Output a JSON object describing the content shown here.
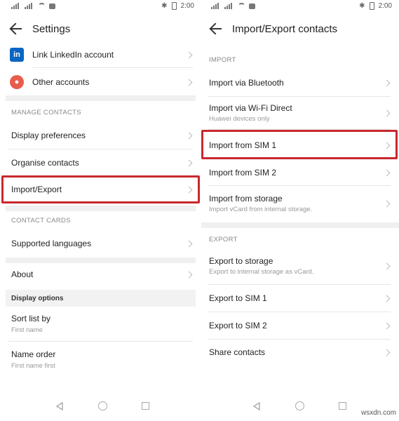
{
  "status_bar": {
    "time": "2:00"
  },
  "left": {
    "title": "Settings",
    "accounts": [
      {
        "label": "Link LinkedIn account",
        "icon": "linkedin-icon"
      },
      {
        "label": "Other accounts",
        "icon": "account-icon"
      }
    ],
    "manage_section": "MANAGE CONTACTS",
    "manage_items": [
      "Display preferences",
      "Organise contacts",
      "Import/Export"
    ],
    "cards_section": "CONTACT CARDS",
    "cards_items": [
      "Supported languages"
    ],
    "about": "About",
    "display_options": "Display options",
    "sort": {
      "label": "Sort list by",
      "value": "First name"
    },
    "order": {
      "label": "Name order",
      "value": "First name first"
    }
  },
  "right": {
    "title": "Import/Export contacts",
    "import_section": "IMPORT",
    "import_items": [
      {
        "label": "Import via Bluetooth",
        "sub": ""
      },
      {
        "label": "Import via Wi-Fi Direct",
        "sub": "Huawei devices only"
      },
      {
        "label": "Import from SIM 1",
        "sub": ""
      },
      {
        "label": "Import from SIM 2",
        "sub": ""
      },
      {
        "label": "Import from storage",
        "sub": "Import vCard from internal storage."
      }
    ],
    "export_section": "EXPORT",
    "export_items": [
      {
        "label": "Export to storage",
        "sub": "Export to internal storage as vCard."
      },
      {
        "label": "Export to SIM 1",
        "sub": ""
      },
      {
        "label": "Export to SIM 2",
        "sub": ""
      },
      {
        "label": "Share contacts",
        "sub": ""
      }
    ]
  },
  "watermark": "wsxdn.com",
  "colors": {
    "highlight": "#c8282e",
    "linkedin": "#0a66c2",
    "account": "#e85d4d"
  }
}
